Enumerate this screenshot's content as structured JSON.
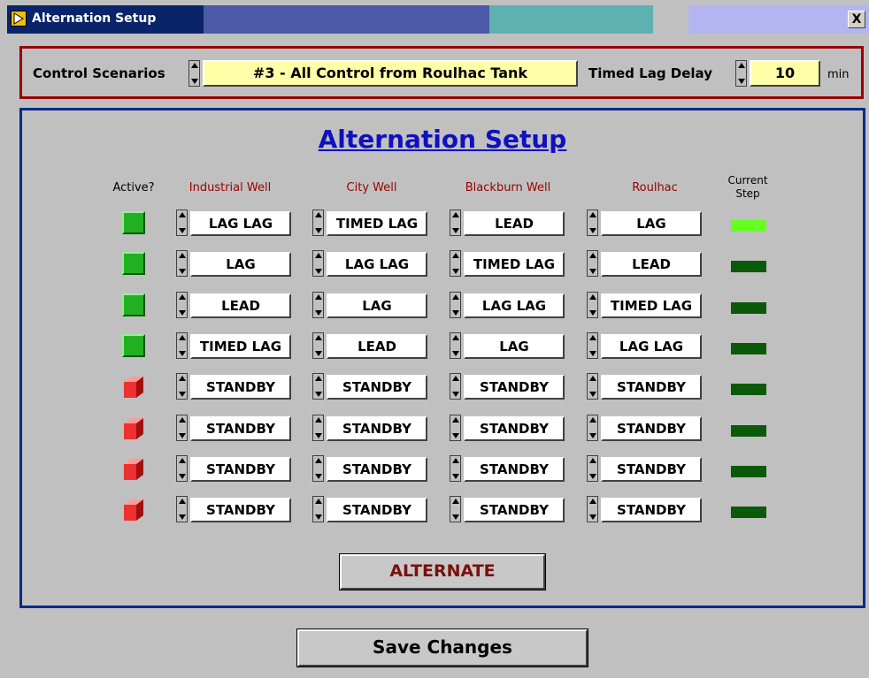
{
  "window": {
    "title": "Alternation Setup",
    "close_glyph": "X"
  },
  "controls": {
    "scenarios_label": "Control Scenarios",
    "scenario_value": "#3 - All Control from Roulhac Tank",
    "lag_delay_label": "Timed Lag Delay",
    "lag_delay_value": "10",
    "lag_delay_unit": "min"
  },
  "panel": {
    "title": "Alternation Setup",
    "headers": {
      "active": "Active?",
      "industrial": "Industrial Well",
      "city": "City Well",
      "blackburn": "Blackburn Well",
      "roulhac": "Roulhac",
      "current_step_line1": "Current",
      "current_step_line2": "Step"
    },
    "rows": [
      {
        "active": true,
        "industrial": "LAG LAG",
        "city": "TIMED LAG",
        "blackburn": "LEAD",
        "roulhac": "LAG",
        "current": true
      },
      {
        "active": true,
        "industrial": "LAG",
        "city": "LAG LAG",
        "blackburn": "TIMED LAG",
        "roulhac": "LEAD",
        "current": false
      },
      {
        "active": true,
        "industrial": "LEAD",
        "city": "LAG",
        "blackburn": "LAG LAG",
        "roulhac": "TIMED LAG",
        "current": false
      },
      {
        "active": true,
        "industrial": "TIMED LAG",
        "city": "LEAD",
        "blackburn": "LAG",
        "roulhac": "LAG LAG",
        "current": false
      },
      {
        "active": false,
        "industrial": "STANDBY",
        "city": "STANDBY",
        "blackburn": "STANDBY",
        "roulhac": "STANDBY",
        "current": false
      },
      {
        "active": false,
        "industrial": "STANDBY",
        "city": "STANDBY",
        "blackburn": "STANDBY",
        "roulhac": "STANDBY",
        "current": false
      },
      {
        "active": false,
        "industrial": "STANDBY",
        "city": "STANDBY",
        "blackburn": "STANDBY",
        "roulhac": "STANDBY",
        "current": false
      },
      {
        "active": false,
        "industrial": "STANDBY",
        "city": "STANDBY",
        "blackburn": "STANDBY",
        "roulhac": "STANDBY",
        "current": false
      }
    ],
    "alternate_label": "ALTERNATE"
  },
  "save_label": "Save Changes",
  "colors": {
    "led_on": "#66ff22",
    "led_off": "#0a5a0a",
    "active_green": "#22b022",
    "inactive_red": "#ee3030",
    "header_red": "#990000",
    "title_blue": "#1010c0"
  }
}
